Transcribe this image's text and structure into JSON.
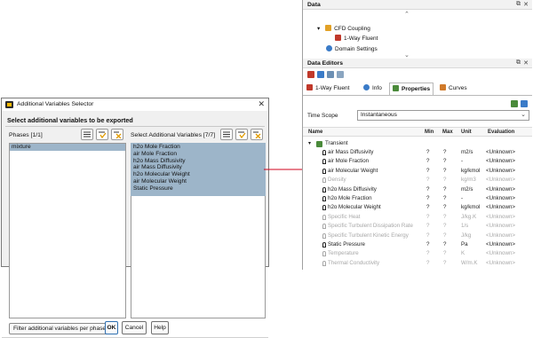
{
  "dialog": {
    "title": "Additional Variables Selector",
    "close_glyph": "✕",
    "heading": "Select additional variables to be exported",
    "phases_label": "Phases [1/1]",
    "phases_items": [
      "mixture"
    ],
    "vars_label": "Select Additional Variables [7/7]",
    "vars_items": [
      "h2o Mole Fraction",
      "air Mole Fraction",
      "h2o Mass Diffusivity",
      "air Mass Diffusivity",
      "h2o Molecular Weight",
      "air Molecular Weight",
      "Static Pressure"
    ],
    "filter_button": "Filter additional variables per phase",
    "ok_button": "OK",
    "cancel_button": "Cancel",
    "help_button": "Help"
  },
  "data_panel": {
    "title": "Data",
    "tree": [
      {
        "label": "CFD Coupling",
        "expander": "▾"
      },
      {
        "label": "1-Way Fluent",
        "expander": ""
      },
      {
        "label": "Domain Settings",
        "expander": ""
      }
    ]
  },
  "editors_panel": {
    "title": "Data Editors",
    "tabs": [
      "1-Way Fluent",
      "Info",
      "Properties",
      "Curves"
    ],
    "active_tab": "Properties",
    "time_scope_label": "Time Scope",
    "time_scope_value": "Instantaneous",
    "columns": [
      "Name",
      "Min",
      "Max",
      "Unit",
      "Evaluation"
    ],
    "group": {
      "label": "Transient",
      "expander": "▾"
    },
    "rows": [
      {
        "name": "air Mass Diffusivity",
        "min": "?",
        "max": "?",
        "unit": "m2/s",
        "eval": "<Unknown>",
        "dim": false
      },
      {
        "name": "air Mole Fraction",
        "min": "?",
        "max": "?",
        "unit": "-",
        "eval": "<Unknown>",
        "dim": false
      },
      {
        "name": "air Molecular Weight",
        "min": "?",
        "max": "?",
        "unit": "kg/kmol",
        "eval": "<Unknown>",
        "dim": false
      },
      {
        "name": "Density",
        "min": "?",
        "max": "?",
        "unit": "kg/m3",
        "eval": "<Unknown>",
        "dim": true
      },
      {
        "name": "h2o Mass Diffusivity",
        "min": "?",
        "max": "?",
        "unit": "m2/s",
        "eval": "<Unknown>",
        "dim": false
      },
      {
        "name": "h2o Mole Fraction",
        "min": "?",
        "max": "?",
        "unit": "-",
        "eval": "<Unknown>",
        "dim": false
      },
      {
        "name": "h2o Molecular Weight",
        "min": "?",
        "max": "?",
        "unit": "kg/kmol",
        "eval": "<Unknown>",
        "dim": false
      },
      {
        "name": "Specific Heat",
        "min": "?",
        "max": "?",
        "unit": "J/kg.K",
        "eval": "<Unknown>",
        "dim": true
      },
      {
        "name": "Specific Turbulent Dissipation Rate",
        "min": "?",
        "max": "?",
        "unit": "1/s",
        "eval": "<Unknown>",
        "dim": true
      },
      {
        "name": "Specific Turbulent Kinetic Energy",
        "min": "?",
        "max": "?",
        "unit": "J/kg",
        "eval": "<Unknown>",
        "dim": true
      },
      {
        "name": "Static Pressure",
        "min": "?",
        "max": "?",
        "unit": "Pa",
        "eval": "<Unknown>",
        "dim": false
      },
      {
        "name": "Temperature",
        "min": "?",
        "max": "?",
        "unit": "K",
        "eval": "<Unknown>",
        "dim": true
      },
      {
        "name": "Thermal Conductivity",
        "min": "?",
        "max": "?",
        "unit": "W/m.K",
        "eval": "<Unknown>",
        "dim": true
      }
    ]
  },
  "colors": {
    "selection": "#9db5c9",
    "arrow": "#d0021b",
    "accent": "#2f6fb0"
  }
}
